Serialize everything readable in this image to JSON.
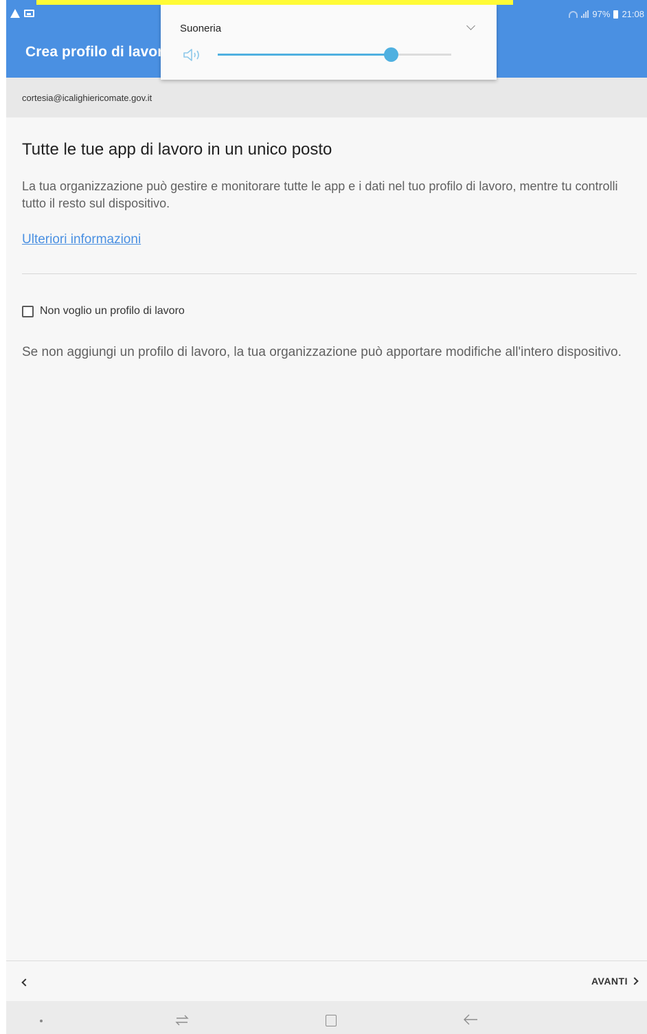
{
  "status_bar": {
    "battery_percent": "97%",
    "time": "21:08"
  },
  "app_bar": {
    "title": "Crea profilo di lavoro"
  },
  "volume_panel": {
    "label": "Suoneria",
    "level": 0.74
  },
  "account": {
    "email": "cortesia@icalighiericomate.gov.it"
  },
  "main": {
    "headline": "Tutte le tue app di lavoro in un unico posto",
    "description": "La tua organizzazione può gestire e monitorare tutte le app e i dati nel tuo profilo di lavoro, mentre tu controlli tutto il resto sul dispositivo.",
    "learn_more": "Ulteriori informazioni",
    "opt_out_label": "Non voglio un profilo di lavoro",
    "opt_out_checked": false,
    "note": "Se non aggiungi un profilo di lavoro, la tua organizzazione può apportare modifiche all'intero dispositivo."
  },
  "footer": {
    "next_label": "AVANTI"
  },
  "colors": {
    "accent": "#4a90e2",
    "highlight": "#fffb36",
    "slider": "#4fb0e0"
  },
  "icons": {
    "status_left": [
      "warning-icon",
      "image-icon"
    ],
    "status_right": [
      "wifi-icon",
      "signal-icon",
      "battery-icon"
    ],
    "volume": "speaker-icon",
    "dropdown": "chevron-down-icon",
    "navigation": [
      "dot-icon",
      "recent-apps-icon",
      "home-icon",
      "back-arrow-icon"
    ]
  }
}
